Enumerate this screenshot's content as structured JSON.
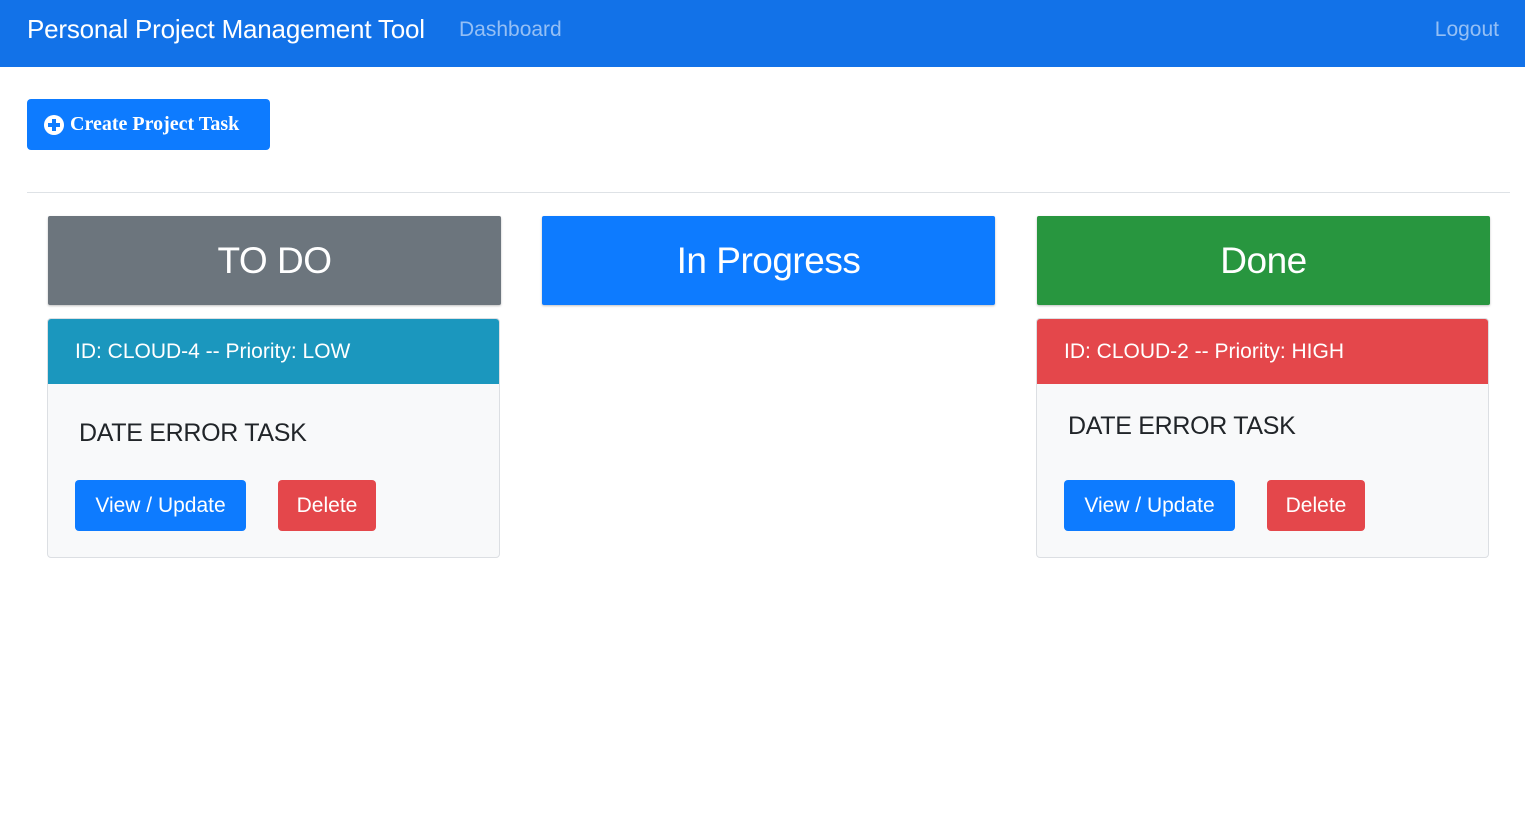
{
  "navbar": {
    "brand": "Personal Project Management Tool",
    "dashboard_label": "Dashboard",
    "logout_label": "Logout"
  },
  "actions": {
    "create_icon": "plus-circle-icon",
    "create_label": "Create Project Task"
  },
  "columns": [
    {
      "title": "TO DO",
      "color": "#6c757d"
    },
    {
      "title": "In Progress",
      "color": "#0d7bff"
    },
    {
      "title": "Done",
      "color": "#28963f"
    }
  ],
  "tasks": [
    {
      "column": "TO DO",
      "header": "ID: CLOUD-4 -- Priority: LOW",
      "header_color": "#1b97be",
      "summary": "DATE ERROR TASK",
      "view_label": "View / Update",
      "delete_label": "Delete"
    },
    {
      "column": "Done",
      "header": "ID: CLOUD-2 -- Priority: HIGH",
      "header_color": "#e4474b",
      "summary": "DATE ERROR TASK",
      "view_label": "View / Update",
      "delete_label": "Delete"
    }
  ]
}
